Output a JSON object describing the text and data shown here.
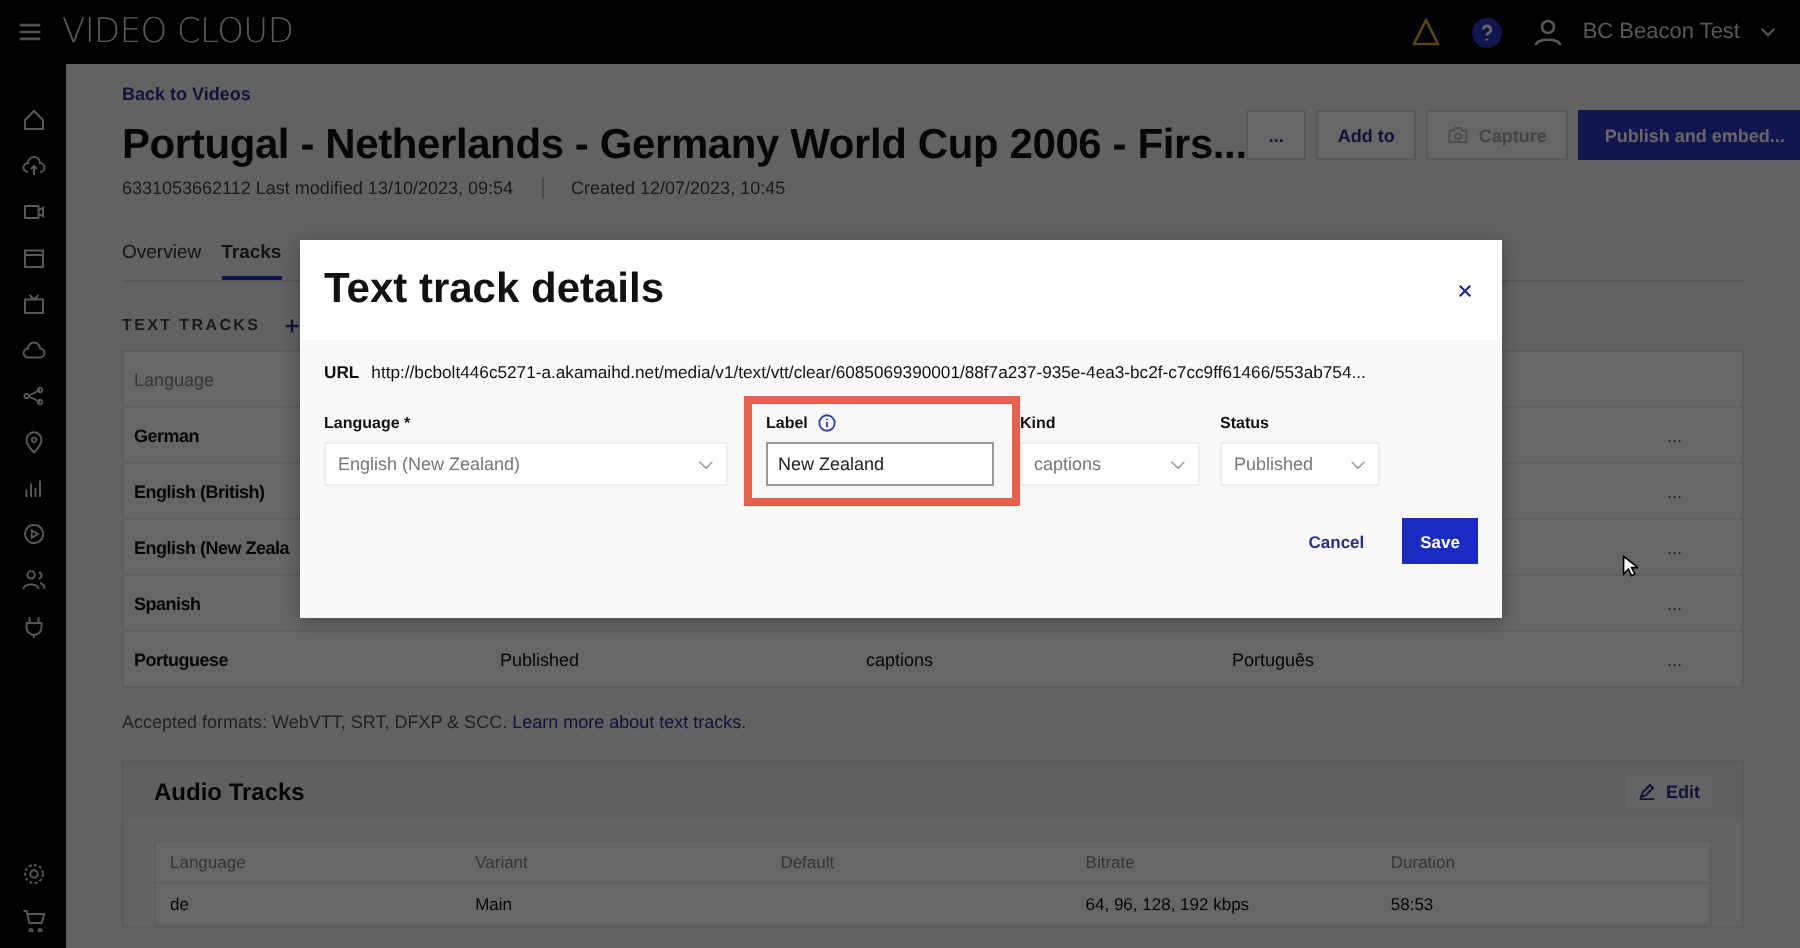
{
  "topbar": {
    "brand": "VIDEO CLOUD",
    "user": "BC Beacon Test"
  },
  "page": {
    "back_link": "Back to Videos",
    "title": "Portugal - Netherlands - Germany World Cup 2006 - Firs...",
    "meta_modified": "6331053662112 Last modified 13/10/2023, 09:54",
    "meta_created": "Created 12/07/2023, 10:45",
    "actions": [
      {
        "label": "...",
        "kind": "plain"
      },
      {
        "label": "Add to",
        "kind": "plain"
      },
      {
        "label": "Capture",
        "kind": "disabled"
      },
      {
        "label": "Publish and embed...",
        "kind": "primary"
      }
    ],
    "tabs": [
      {
        "label": "Overview",
        "selected": false
      },
      {
        "label": "Tracks",
        "selected": true
      }
    ],
    "text_tracks": {
      "heading": "TEXT TRACKS",
      "columns": [
        "Language"
      ],
      "rows": [
        {
          "language": "German",
          "menu": "..."
        },
        {
          "language": "English (British)",
          "menu": "..."
        },
        {
          "language": "English (New Zeala",
          "menu": "..."
        },
        {
          "language": "Spanish",
          "menu": "..."
        },
        {
          "language": "Portuguese",
          "status": "Published",
          "kind": "captions",
          "label": "Português",
          "menu": "..."
        }
      ]
    },
    "formats_note": "Accepted formats: WebVTT, SRT, DFXP & SCC.",
    "formats_link": "Learn more about text tracks.",
    "audio_tracks": {
      "title": "Audio Tracks",
      "edit_label": "Edit",
      "columns": [
        "Language",
        "Variant",
        "Default",
        "Bitrate",
        "Duration"
      ],
      "rows": [
        [
          "de",
          "Main",
          "",
          "64, 96, 128, 192 kbps",
          "58:53"
        ]
      ]
    }
  },
  "modal": {
    "title": "Text track details",
    "url_label": "URL",
    "url": "http://bcbolt446c5271-a.akamaihd.net/media/v1/text/vtt/clear/6085069390001/88f7a237-935e-4ea3-bc2f-c7cc9ff61466/553ab754...",
    "fields": [
      {
        "kind": "select",
        "label": "Language *",
        "value": "English (New Zealand)",
        "info": false,
        "highlighted": false
      },
      {
        "kind": "input",
        "label": "Label",
        "value": "New Zealand",
        "info": true,
        "highlighted": true
      },
      {
        "kind": "select",
        "label": "Kind",
        "value": "captions",
        "info": false,
        "highlighted": false
      },
      {
        "kind": "select",
        "label": "Status",
        "value": "Published",
        "info": false,
        "highlighted": false
      }
    ],
    "buttons": [
      {
        "label": "Cancel",
        "kind": "link"
      },
      {
        "label": "Save",
        "kind": "primary"
      }
    ]
  }
}
